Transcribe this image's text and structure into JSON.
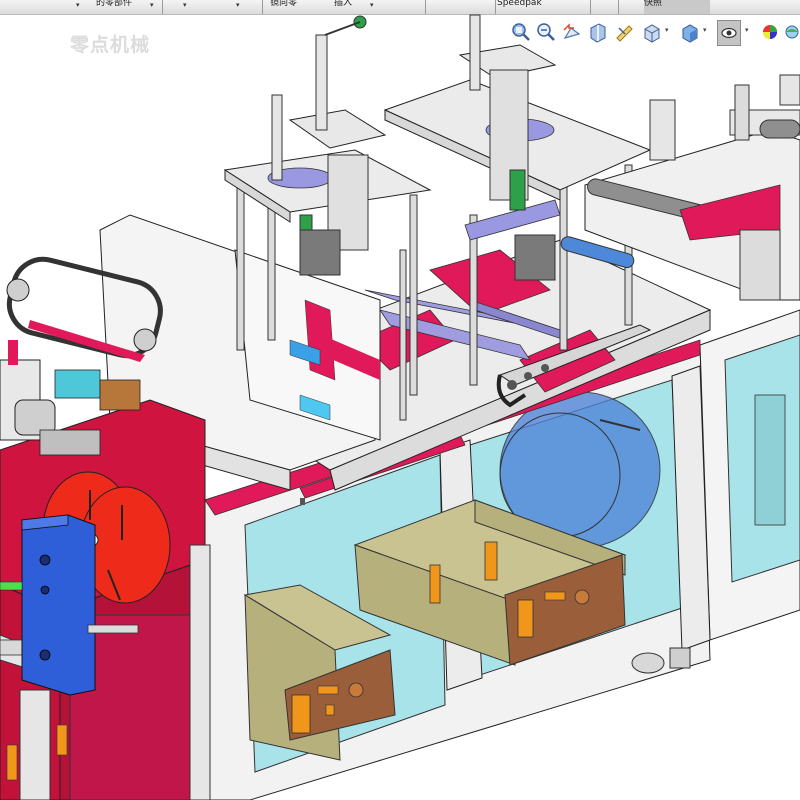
{
  "toolbar": {
    "items": [
      {
        "label": "的零部件",
        "has_dropdown": true
      },
      {
        "label": "",
        "has_dropdown": true
      },
      {
        "label": "",
        "has_dropdown": true
      },
      {
        "label": "镜向零",
        "has_dropdown": false
      },
      {
        "label": "插入",
        "has_dropdown": true
      },
      {
        "label": "Speedpak",
        "has_dropdown": false
      },
      {
        "label": "",
        "has_dropdown": false
      },
      {
        "label": "快照",
        "has_dropdown": false
      }
    ]
  },
  "view_toolbar": {
    "icons": [
      "zoom-to-fit-icon",
      "zoom-to-area-icon",
      "previous-view-icon",
      "section-view-icon",
      "dynamic-annotation-icon",
      "view-orientation-icon",
      "display-style-icon",
      "hide-show-items-icon",
      "edit-appearance-icon",
      "apply-scene-icon"
    ]
  },
  "watermark": "零点机械",
  "colors": {
    "frame_pink": "#e0195a",
    "cabinet_red": "#d01440",
    "reel_red": "#ee2a1a",
    "glass_cyan": "#a8e6ec",
    "box_khaki": "#b3ad7a",
    "panel_brown": "#9a5e3a",
    "label_orange": "#f0961a",
    "blue_bracket": "#2e5ed8",
    "lavender": "#a09ce0",
    "steel_gray": "#cfcfcf"
  }
}
